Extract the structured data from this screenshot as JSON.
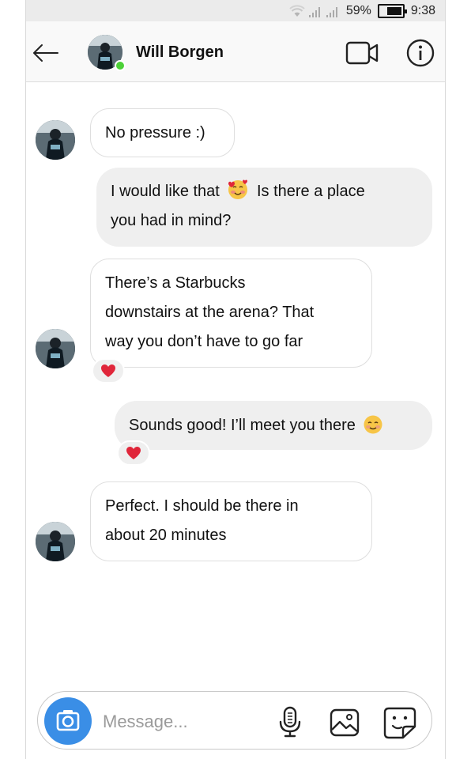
{
  "status_bar": {
    "battery_percent": "59%",
    "time": "9:38",
    "icons": [
      "wifi-icon",
      "signal-icon",
      "signal-icon",
      "battery-icon"
    ]
  },
  "header": {
    "contact_name": "Will Borgen",
    "online": true,
    "icons": [
      "back-arrow-icon",
      "video-call-icon",
      "info-icon"
    ]
  },
  "messages": [
    {
      "from": "them",
      "text": "No pressure :)"
    },
    {
      "from": "me",
      "lines": [
        "I would like that",
        "Is there a place",
        "you had in mind?"
      ],
      "emoji": "smiling-face-with-hearts"
    },
    {
      "from": "them",
      "lines": [
        "There’s a Starbucks",
        "downstairs at the arena? That",
        "way you don’t have to go far"
      ],
      "reaction": "heart"
    },
    {
      "from": "me",
      "text": "Sounds good! I’ll meet you there",
      "emoji": "smiling-face",
      "reaction": "heart"
    },
    {
      "from": "them",
      "lines": [
        "Perfect. I should be there in",
        "about 20 minutes"
      ]
    }
  ],
  "composer": {
    "placeholder": "Message...",
    "icons": [
      "camera-icon",
      "microphone-icon",
      "gallery-icon",
      "sticker-icon"
    ]
  },
  "colors": {
    "camera_button": "#3a8ee6",
    "online_dot": "#4cd137",
    "reaction_heart": "#e0263a",
    "outgoing_bubble": "#efefef"
  }
}
